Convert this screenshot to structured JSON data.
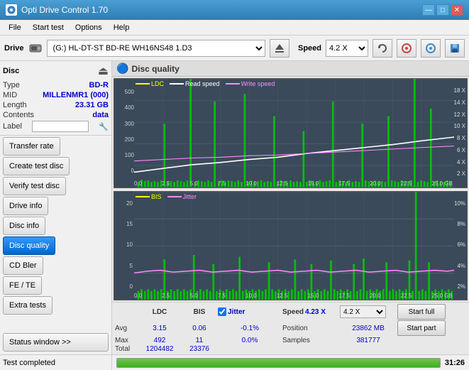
{
  "titlebar": {
    "title": "Opti Drive Control 1.70",
    "minimize": "—",
    "maximize": "□",
    "close": "✕"
  },
  "menu": {
    "items": [
      "File",
      "Start test",
      "Options",
      "Help"
    ]
  },
  "toolbar": {
    "drive_label": "Drive",
    "drive_value": "(G:)  HL-DT-ST BD-RE  WH16NS48 1.D3",
    "speed_label": "Speed",
    "speed_value": "4.2 X"
  },
  "disc": {
    "title": "Disc",
    "type_label": "Type",
    "type_value": "BD-R",
    "mid_label": "MID",
    "mid_value": "MILLENMR1 (000)",
    "length_label": "Length",
    "length_value": "23.31 GB",
    "contents_label": "Contents",
    "contents_value": "data",
    "label_label": "Label"
  },
  "sidebar_buttons": [
    {
      "label": "Transfer rate",
      "id": "transfer-rate",
      "active": false
    },
    {
      "label": "Create test disc",
      "id": "create-test-disc",
      "active": false
    },
    {
      "label": "Verify test disc",
      "id": "verify-test-disc",
      "active": false
    },
    {
      "label": "Drive info",
      "id": "drive-info",
      "active": false
    },
    {
      "label": "Disc info",
      "id": "disc-info",
      "active": false
    },
    {
      "label": "Disc quality",
      "id": "disc-quality",
      "active": true
    },
    {
      "label": "CD Bler",
      "id": "cd-bler",
      "active": false
    },
    {
      "label": "FE / TE",
      "id": "fe-te",
      "active": false
    },
    {
      "label": "Extra tests",
      "id": "extra-tests",
      "active": false
    }
  ],
  "chart_title": "Disc quality",
  "chart1": {
    "legend": [
      {
        "label": "LDC",
        "color": "#ffff00"
      },
      {
        "label": "Read speed",
        "color": "#ffffff"
      },
      {
        "label": "Write speed",
        "color": "#ff88ff"
      }
    ],
    "y_left": [
      "500",
      "400",
      "300",
      "200",
      "100",
      "0"
    ],
    "y_right": [
      "18 X",
      "14 X",
      "12 X",
      "10 X",
      "8 X",
      "6 X",
      "4 X",
      "2 X"
    ],
    "x_axis": [
      "0.0",
      "2.5",
      "5.0",
      "7.5",
      "10.0",
      "12.5",
      "15.0",
      "17.5",
      "20.0",
      "22.5",
      "25.0 GB"
    ]
  },
  "chart2": {
    "legend": [
      {
        "label": "BIS",
        "color": "#ffff00"
      },
      {
        "label": "Jitter",
        "color": "#ff88ff"
      }
    ],
    "y_left": [
      "20",
      "15",
      "10",
      "5",
      "0"
    ],
    "y_right": [
      "10%",
      "8%",
      "6%",
      "4%",
      "2%"
    ],
    "x_axis": [
      "0.0",
      "2.5",
      "5.0",
      "7.5",
      "10.0",
      "12.5",
      "15.0",
      "17.5",
      "20.0",
      "22.5",
      "25.0 GB"
    ]
  },
  "stats": {
    "col_headers": [
      "",
      "LDC",
      "BIS",
      "",
      "Jitter",
      "Speed",
      ""
    ],
    "rows": [
      {
        "label": "Avg",
        "ldc": "3.15",
        "bis": "0.06",
        "jitter": "-0.1%",
        "speed_label": "Speed",
        "speed_val": "4.23 X"
      },
      {
        "label": "Max",
        "ldc": "492",
        "bis": "11",
        "jitter": "0.0%",
        "speed_label": "Position",
        "speed_val": "23862 MB"
      },
      {
        "label": "Total",
        "ldc": "1204482",
        "bis": "23376",
        "jitter": "",
        "speed_label": "Samples",
        "speed_val": "381777"
      }
    ],
    "jitter_checked": true,
    "speed_dropdown": "4.2 X",
    "start_full": "Start full",
    "start_part": "Start part"
  },
  "statusbar": {
    "status_window": "Status window >>",
    "test_completed": "Test completed",
    "progress": 100,
    "time": "31:26"
  }
}
